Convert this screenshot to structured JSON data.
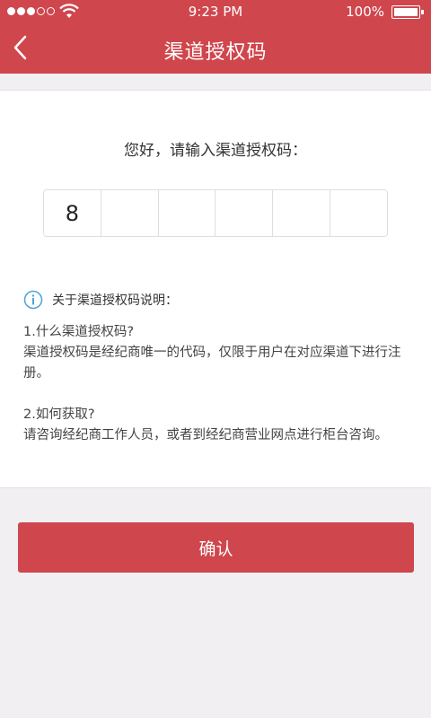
{
  "status_bar": {
    "time": "9:23 PM",
    "battery_percent": "100%",
    "signal_dots_filled": 3,
    "signal_dots_total": 5
  },
  "nav": {
    "title": "渠道授权码",
    "back_icon": "chevron-left-icon"
  },
  "form": {
    "prompt": "您好，请输入渠道授权码：",
    "code_digits": [
      "8",
      "",
      "",
      "",
      "",
      ""
    ]
  },
  "info": {
    "title": "关于渠道授权码说明：",
    "icon": "info-icon",
    "q1": "1.什么渠道授权码?",
    "a1": "渠道授权码是经纪商唯一的代码，仅限于用户在对应渠道下进行注册。",
    "q2": "2.如何获取?",
    "a2": "请咨询经纪商工作人员，或者到经纪商营业网点进行柜台咨询。"
  },
  "confirm_label": "确认",
  "colors": {
    "accent": "#d0464d",
    "background": "#f1eff2",
    "info_icon": "#4ea3d8"
  }
}
